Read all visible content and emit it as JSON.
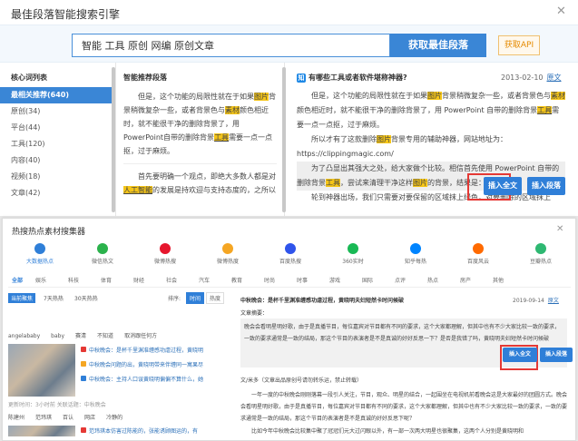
{
  "top": {
    "title": "最佳段落智能搜索引擎",
    "close_glyph": "✕",
    "search_value": "智能 工具 原创 网编 原创文章",
    "search_button": "获取最佳段落",
    "api_button": "获取API",
    "left": {
      "header": "核心词列表",
      "items": [
        {
          "label": "最相关推荐(640)",
          "active": true
        },
        {
          "label": "原创(34)"
        },
        {
          "label": "平台(44)"
        },
        {
          "label": "工具(120)"
        },
        {
          "label": "内容(40)"
        },
        {
          "label": "视频(18)"
        },
        {
          "label": "文章(42)"
        }
      ]
    },
    "mid": {
      "header": "智能推荐段落",
      "p1_a": "但是，这个功能的局限性就在于如果",
      "p1_hl1": "图片",
      "p1_b": "背景稍微复杂一些，或者背景色与",
      "p1_hl2": "素材",
      "p1_c": "颜色相近时，就不能很干净的删除背景了，用PowerPoint自带的删除背景",
      "p1_hl3": "工具",
      "p1_d": "需要一点一点抠，过于麻烦。",
      "p2_a": "首先要明确一个观点，即绝大多数人都是对",
      "p2_hl1": "人工智能",
      "p2_b": "的发展是持欢迎与支持态度的，之所以"
    },
    "right": {
      "zhi_icon": "知",
      "question": "有哪些工具或者软件堪称神器?",
      "date": "2013-02-10",
      "origin_link": "原文",
      "p1_a": "但是，这个功能的局限性就在于如果",
      "p1_hl1": "图片",
      "p1_b": "背景稍微复杂一些，或者背景色与",
      "p1_hl2": "素材",
      "p1_c": "颜色相近时，就不能很干净的删除背景了，用 PowerPoint 自带的删除背景",
      "p1_hl3": "工具",
      "p1_d": "需要一点一点抠，过于麻烦。",
      "p2_a": "所以才有了这款删除",
      "p2_hl1": "图片",
      "p2_b": "背景专用的辅助神器，网站地址为：https://clippingmagic.com/",
      "p3_a": "为了凸显出其强大之处，给大家做个比较。相信首先使用 PowerPoint 自带的删除背景",
      "p3_hl1": "工具",
      "p3_b": "，尝试来清理干净这样",
      "p3_hl2": "图片",
      "p3_c": "的背景，结果是：",
      "p4": "轮到神器出场，我们只需要对要保留的区域抹上绿色，对要删除的区域抹上",
      "insert_full": "插入全文",
      "insert_para": "插入段落"
    }
  },
  "bottom": {
    "title": "热搜热点素材搜集器",
    "close_glyph": "✕",
    "categories": [
      {
        "label": "大数据热点",
        "color": "#2f7fd8",
        "active": true
      },
      {
        "label": "微信热文",
        "color": "#2bb24c"
      },
      {
        "label": "微博热搜",
        "color": "#e6162d"
      },
      {
        "label": "微博热度",
        "color": "#f5a623"
      },
      {
        "label": "百度热搜",
        "color": "#2f54eb"
      },
      {
        "label": "360实时",
        "color": "#19b955"
      },
      {
        "label": "知乎每热",
        "color": "#0084ff"
      },
      {
        "label": "百度风云",
        "color": "#ff6a00"
      },
      {
        "label": "豆瓣热点",
        "color": "#2eb872"
      }
    ],
    "subtabs": [
      "全部",
      "娱乐",
      "科技",
      "体育",
      "财经",
      "社会",
      "汽车",
      "教育",
      "时尚",
      "时事",
      "游戏",
      "国际",
      "点评",
      "热点",
      "房产",
      "其他"
    ],
    "filter": {
      "tag_on": "当前聚焦",
      "tag2": "7天热热",
      "tag3": "30天热热",
      "sort_label": "排序:",
      "sort_time": "时间",
      "sort_hot": "热度"
    },
    "kw1": [
      "angelababy",
      "baby",
      "赛清",
      "不知道",
      "取消跟任何方"
    ],
    "item1_t1": "中秋晚会：是杯千里渊准缠感功虐过程，黄晓明",
    "item1_t2": "中秋晚会问题的出，黄晓明带来伴缠同一寓果尽",
    "item1_t3": "中秋晚会：主持人口误黄晓明偏偏不算什么，她",
    "item1_meta": "更新时间：3小时前    关联话题：中秋晚会",
    "kw2": [
      "陈建州",
      "范玮琪",
      "百认",
      "网店",
      "冷静的"
    ],
    "item2_t1": "范玮琪本仿害过陈能的，张能诱顾图运的，有",
    "detail": {
      "title": "中秋晚会：是杯千里渊准缠感功虐过程，黄晓明夫妇短然卡时问候破",
      "date": "2019-09-14",
      "origin": "原文",
      "sub": "文章摘要：",
      "summary": "晚会会看明星明好歌，由于是真播节目，每位嘉宾对节目都有不同的要求，这个大家都理解，但其中也有不少大家比较一致的要求，一致的要求通常是一致的结局，那这个节目的表演者是不是真诚的好好反思一下？是否是我错了吗，黄晓明夫妇短然卡时问候破",
      "author": "文/米多（文章出品原创号请勿转乐运，禁止转载）",
      "para1": "一年一度的中秋晚会刚刚落幕一段引人关注，节目，观众、明星的结合，一起围坐在电视机前看晚会这是大家最好的团圆方式。晚会会看明星明好歌，由于是真播节目，每位嘉宾对节目都有不同的要求，这个大家都理解，但其中也有不少大家比较一致的要求，一致的要求通常是一致的结局，那这个节目的表演者是不是真诚的好好反思下呢？",
      "para2": "比如今年中秋晚会比较集中聚了冠冠们元大过闪眼以外，有一部一次两大明星也很聚集，这两个人分别是黄晓明和",
      "insert_full": "插入全文",
      "insert_para": "插入段落"
    }
  }
}
